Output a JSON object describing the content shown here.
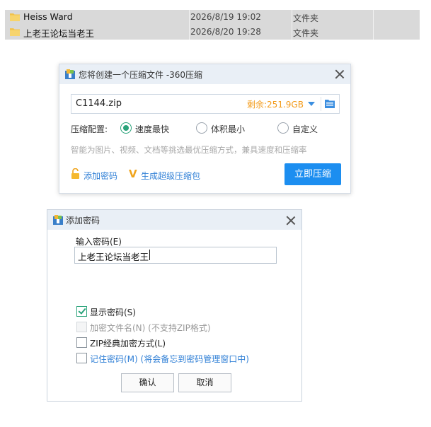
{
  "files": [
    {
      "name": "Heiss Ward",
      "date": "2026/8/19 19:02",
      "type": "文件夹",
      "icon": "folder-icon"
    },
    {
      "name": "上老王论坛当老王",
      "date": "2026/8/20 19:28",
      "type": "文件夹",
      "icon": "folder-icon"
    }
  ],
  "zip_dialog": {
    "title": "您将创建一个压缩文件 -360压缩",
    "filename": "C1144.zip",
    "remaining": "剩余:251.9GB",
    "config_label": "压缩配置:",
    "options": [
      "速度最快",
      "体积最小",
      "自定义"
    ],
    "selected_option": "速度最快",
    "hint": "智能为图片、视频、文档等挑选最优压缩方式，兼具速度和压缩率",
    "add_password": "添加密码",
    "super_pack": "生成超级压缩包",
    "compress_button": "立即压缩",
    "colors": {
      "accent": "#1c8ef0",
      "remaining": "#f39b1a",
      "link": "#2f7fd6",
      "radio": "#2aa37a"
    }
  },
  "password_dialog": {
    "title": "添加密码",
    "input_label": "输入密码(E)",
    "password_value": "上老王论坛当老王",
    "checkboxes": [
      {
        "label": "显示密码(S)",
        "checked": true,
        "enabled": true
      },
      {
        "label": "加密文件名(N) (不支持ZIP格式)",
        "checked": false,
        "enabled": false
      },
      {
        "label": "ZIP经典加密方式(L)",
        "checked": false,
        "enabled": true
      },
      {
        "label": "记住密码(M) (将会备忘到密码管理窗口中)",
        "checked": false,
        "enabled": true
      }
    ],
    "ok_button": "确认",
    "cancel_button": "取消"
  }
}
